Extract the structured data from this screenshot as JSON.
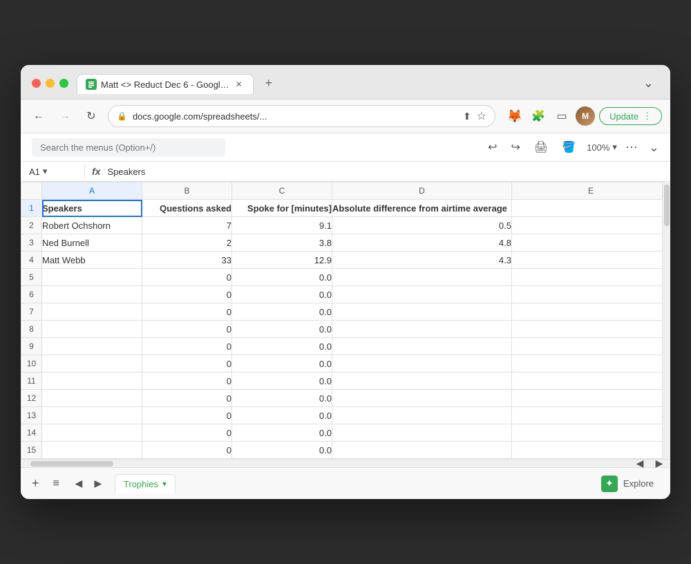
{
  "window": {
    "title": "Matt <> Reduct Dec 6 - Googl…"
  },
  "browser": {
    "url": "docs.google.com/spreadsheets/...",
    "back_disabled": false,
    "forward_disabled": true,
    "update_label": "Update",
    "zoom": "100%"
  },
  "toolbar": {
    "search_placeholder": "Search the menus (Option+/)"
  },
  "formula_bar": {
    "cell_ref": "A1",
    "formula": "Speakers"
  },
  "spreadsheet": {
    "columns": [
      "",
      "A",
      "B",
      "C",
      "D",
      "E"
    ],
    "headers": {
      "A": "Speakers",
      "B": "Questions asked",
      "C": "Spoke for [minutes]",
      "D": "Absolute difference from airtime average",
      "E": ""
    },
    "rows": [
      {
        "row": 1,
        "A": "Speakers",
        "B": "Questions asked",
        "C": "Spoke for [minutes]",
        "D": "Absolute difference from airtime average",
        "is_header": true
      },
      {
        "row": 2,
        "A": "Robert Ochshorn",
        "B": "7",
        "C": "9.1",
        "D": "0.5"
      },
      {
        "row": 3,
        "A": "Ned Burnell",
        "B": "2",
        "C": "3.8",
        "D": "4.8"
      },
      {
        "row": 4,
        "A": "Matt Webb",
        "B": "33",
        "C": "12.9",
        "D": "4.3"
      },
      {
        "row": 5,
        "A": "",
        "B": "0",
        "C": "0.0",
        "D": ""
      },
      {
        "row": 6,
        "A": "",
        "B": "0",
        "C": "0.0",
        "D": ""
      },
      {
        "row": 7,
        "A": "",
        "B": "0",
        "C": "0.0",
        "D": ""
      },
      {
        "row": 8,
        "A": "",
        "B": "0",
        "C": "0.0",
        "D": ""
      },
      {
        "row": 9,
        "A": "",
        "B": "0",
        "C": "0.0",
        "D": ""
      },
      {
        "row": 10,
        "A": "",
        "B": "0",
        "C": "0.0",
        "D": ""
      },
      {
        "row": 11,
        "A": "",
        "B": "0",
        "C": "0.0",
        "D": ""
      },
      {
        "row": 12,
        "A": "",
        "B": "0",
        "C": "0.0",
        "D": ""
      },
      {
        "row": 13,
        "A": "",
        "B": "0",
        "C": "0.0",
        "D": ""
      },
      {
        "row": 14,
        "A": "",
        "B": "0",
        "C": "0.0",
        "D": ""
      },
      {
        "row": 15,
        "A": "",
        "B": "0",
        "C": "0.0",
        "D": ""
      }
    ]
  },
  "sheet_tab": {
    "name": "Trophies",
    "dropdown_arrow": "▾"
  },
  "bottom": {
    "explore_label": "Explore",
    "add_sheet_label": "+",
    "sheets_list_label": "≡"
  }
}
